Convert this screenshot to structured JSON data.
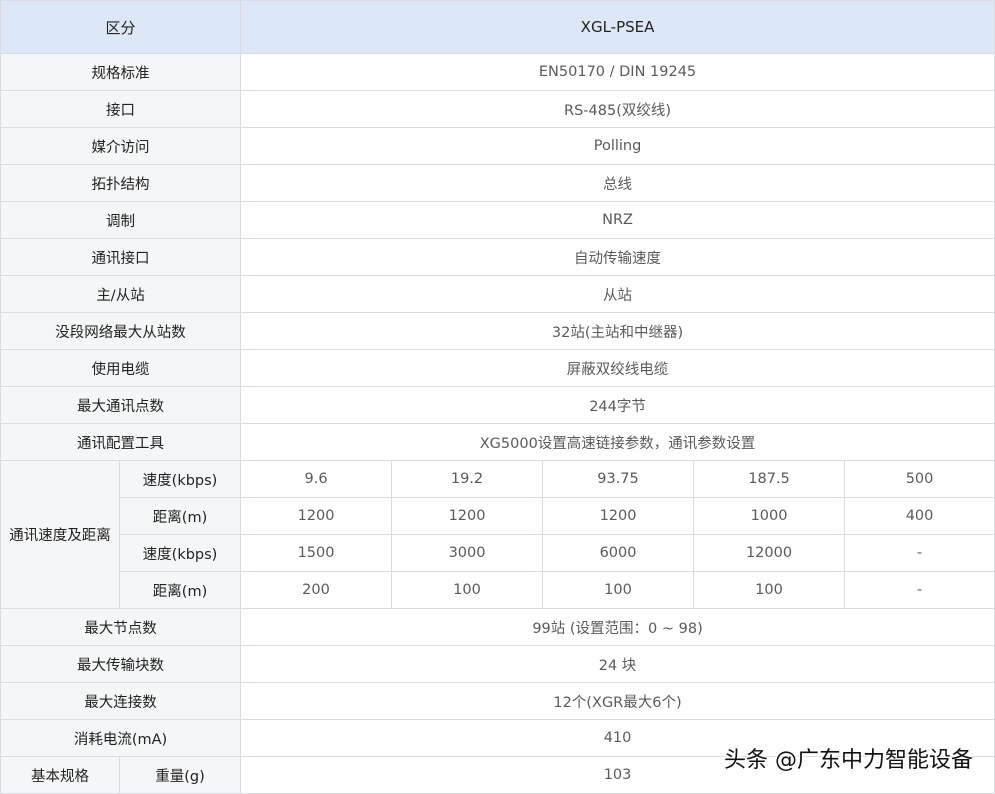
{
  "header": {
    "col1": "区分",
    "col2": "XGL-PSEA"
  },
  "rows_top": [
    {
      "label": "规格标准",
      "value": "EN50170 / DIN 19245"
    },
    {
      "label": "接口",
      "value": "RS-485(双绞线)"
    },
    {
      "label": "媒介访问",
      "value": "Polling"
    },
    {
      "label": "拓扑结构",
      "value": "总线"
    },
    {
      "label": "调制",
      "value": "NRZ"
    },
    {
      "label": "通讯接口",
      "value": "自动传输速度"
    },
    {
      "label": "主/从站",
      "value": "从站"
    },
    {
      "label": "没段网络最大从站数",
      "value": "32站(主站和中继器)"
    },
    {
      "label": "使用电缆",
      "value": "屏蔽双绞线电缆"
    },
    {
      "label": "最大通讯点数",
      "value": "244字节"
    },
    {
      "label": "通讯配置工具",
      "value": "XG5000设置高速链接参数，通讯参数设置"
    }
  ],
  "speed_group": {
    "label": "通讯速度及距离",
    "rows": [
      {
        "sublabel": "速度(kbps)",
        "values": [
          "9.6",
          "19.2",
          "93.75",
          "187.5",
          "500"
        ]
      },
      {
        "sublabel": "距离(m)",
        "values": [
          "1200",
          "1200",
          "1200",
          "1000",
          "400"
        ]
      },
      {
        "sublabel": "速度(kbps)",
        "values": [
          "1500",
          "3000",
          "6000",
          "12000",
          "-"
        ]
      },
      {
        "sublabel": "距离(m)",
        "values": [
          "200",
          "100",
          "100",
          "100",
          "-"
        ]
      }
    ]
  },
  "rows_bottom": [
    {
      "label": "最大节点数",
      "value": "99站 (设置范围：0 ~ 98)"
    },
    {
      "label": "最大传输块数",
      "value": "24 块"
    },
    {
      "label": "最大连接数",
      "value": "12个(XGR最大6个)"
    },
    {
      "label": "消耗电流(mA)",
      "value": "410"
    }
  ],
  "basic": {
    "label": "基本规格",
    "sublabel": "重量(g)",
    "value": "103"
  },
  "watermark": "头条 @广东中力智能设备"
}
